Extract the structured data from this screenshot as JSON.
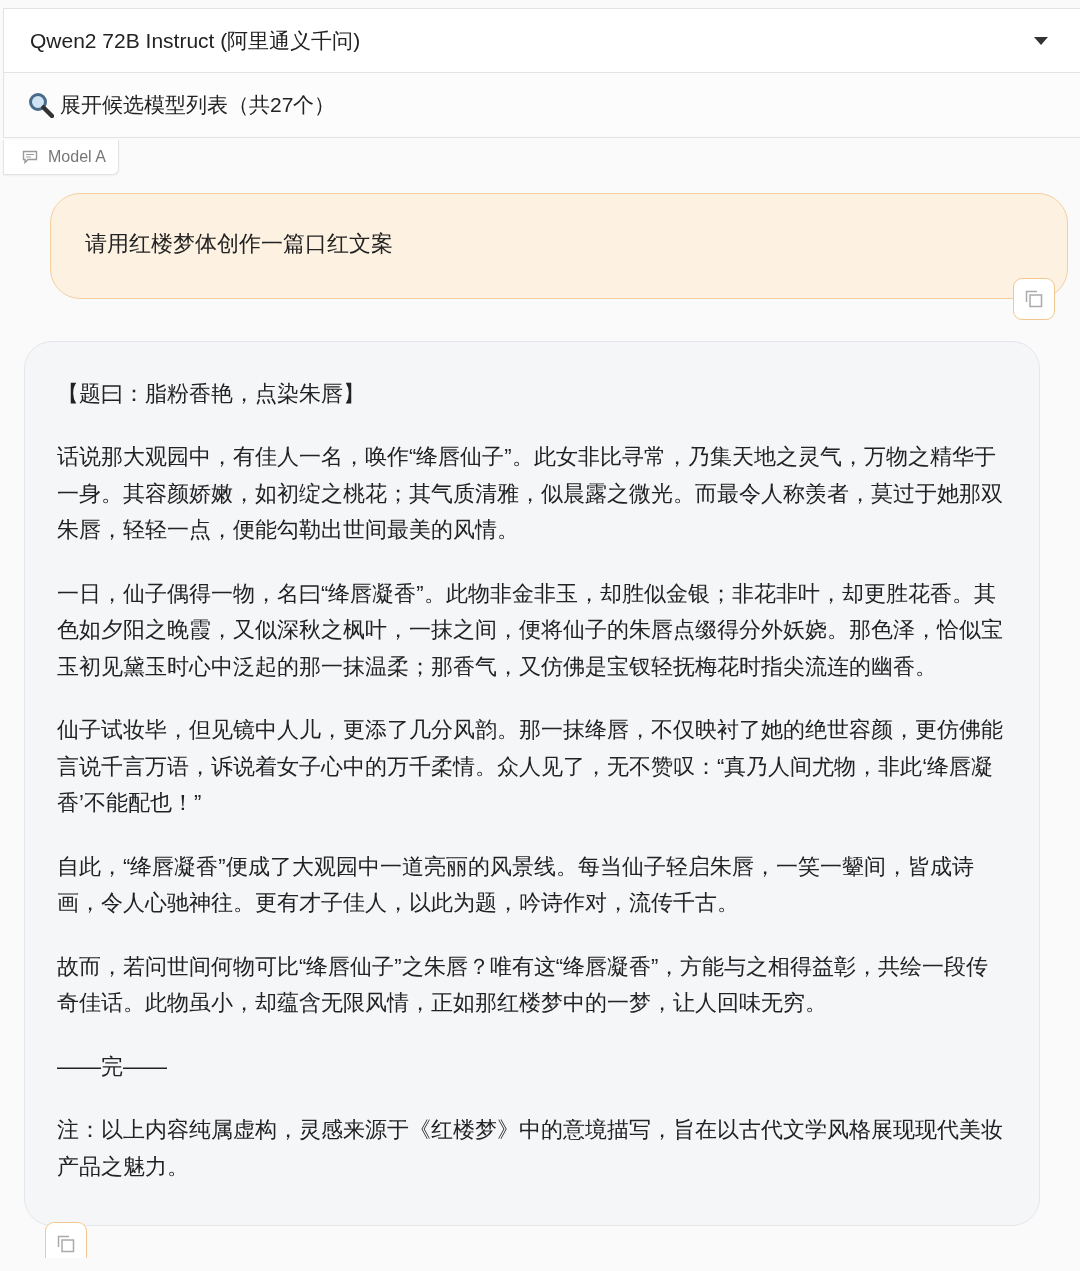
{
  "model_select": {
    "value": "Qwen2 72B Instruct (阿里通义千问)"
  },
  "expand_models": {
    "label": "展开候选模型列表（共27个）"
  },
  "chat_label": "Model A",
  "messages": [
    {
      "kind": "user",
      "paragraphs": [
        "请用红楼梦体创作一篇口红文案"
      ]
    },
    {
      "kind": "assistant",
      "paragraphs": [
        "【题曰：脂粉香艳，点染朱唇】",
        "话说那大观园中，有佳人一名，唤作“绛唇仙子”。此女非比寻常，乃集天地之灵气，万物之精华于一身。其容颜娇嫩，如初绽之桃花；其气质清雅，似晨露之微光。而最令人称羡者，莫过于她那双朱唇，轻轻一点，便能勾勒出世间最美的风情。",
        "一日，仙子偶得一物，名曰“绛唇凝香”。此物非金非玉，却胜似金银；非花非叶，却更胜花香。其色如夕阳之晚霞，又似深秋之枫叶，一抹之间，便将仙子的朱唇点缀得分外妖娆。那色泽，恰似宝玉初见黛玉时心中泛起的那一抹温柔；那香气，又仿佛是宝钗轻抚梅花时指尖流连的幽香。",
        "仙子试妆毕，但见镜中人儿，更添了几分风韵。那一抹绛唇，不仅映衬了她的绝世容颜，更仿佛能言说千言万语，诉说着女子心中的万千柔情。众人见了，无不赞叹：“真乃人间尤物，非此‘绛唇凝香’不能配也！”",
        "自此，“绛唇凝香”便成了大观园中一道亮丽的风景线。每当仙子轻启朱唇，一笑一颦间，皆成诗画，令人心驰神往。更有才子佳人，以此为题，吟诗作对，流传千古。",
        "故而，若问世间何物可比“绛唇仙子”之朱唇？唯有这“绛唇凝香”，方能与之相得益彰，共绘一段传奇佳话。此物虽小，却蕴含无限风情，正如那红楼梦中的一梦，让人回味无穷。",
        "——完——",
        "注：以上内容纯属虚构，灵感来源于《红楼梦》中的意境描写，旨在以古代文学风格展现现代美妆产品之魅力。"
      ]
    }
  ]
}
